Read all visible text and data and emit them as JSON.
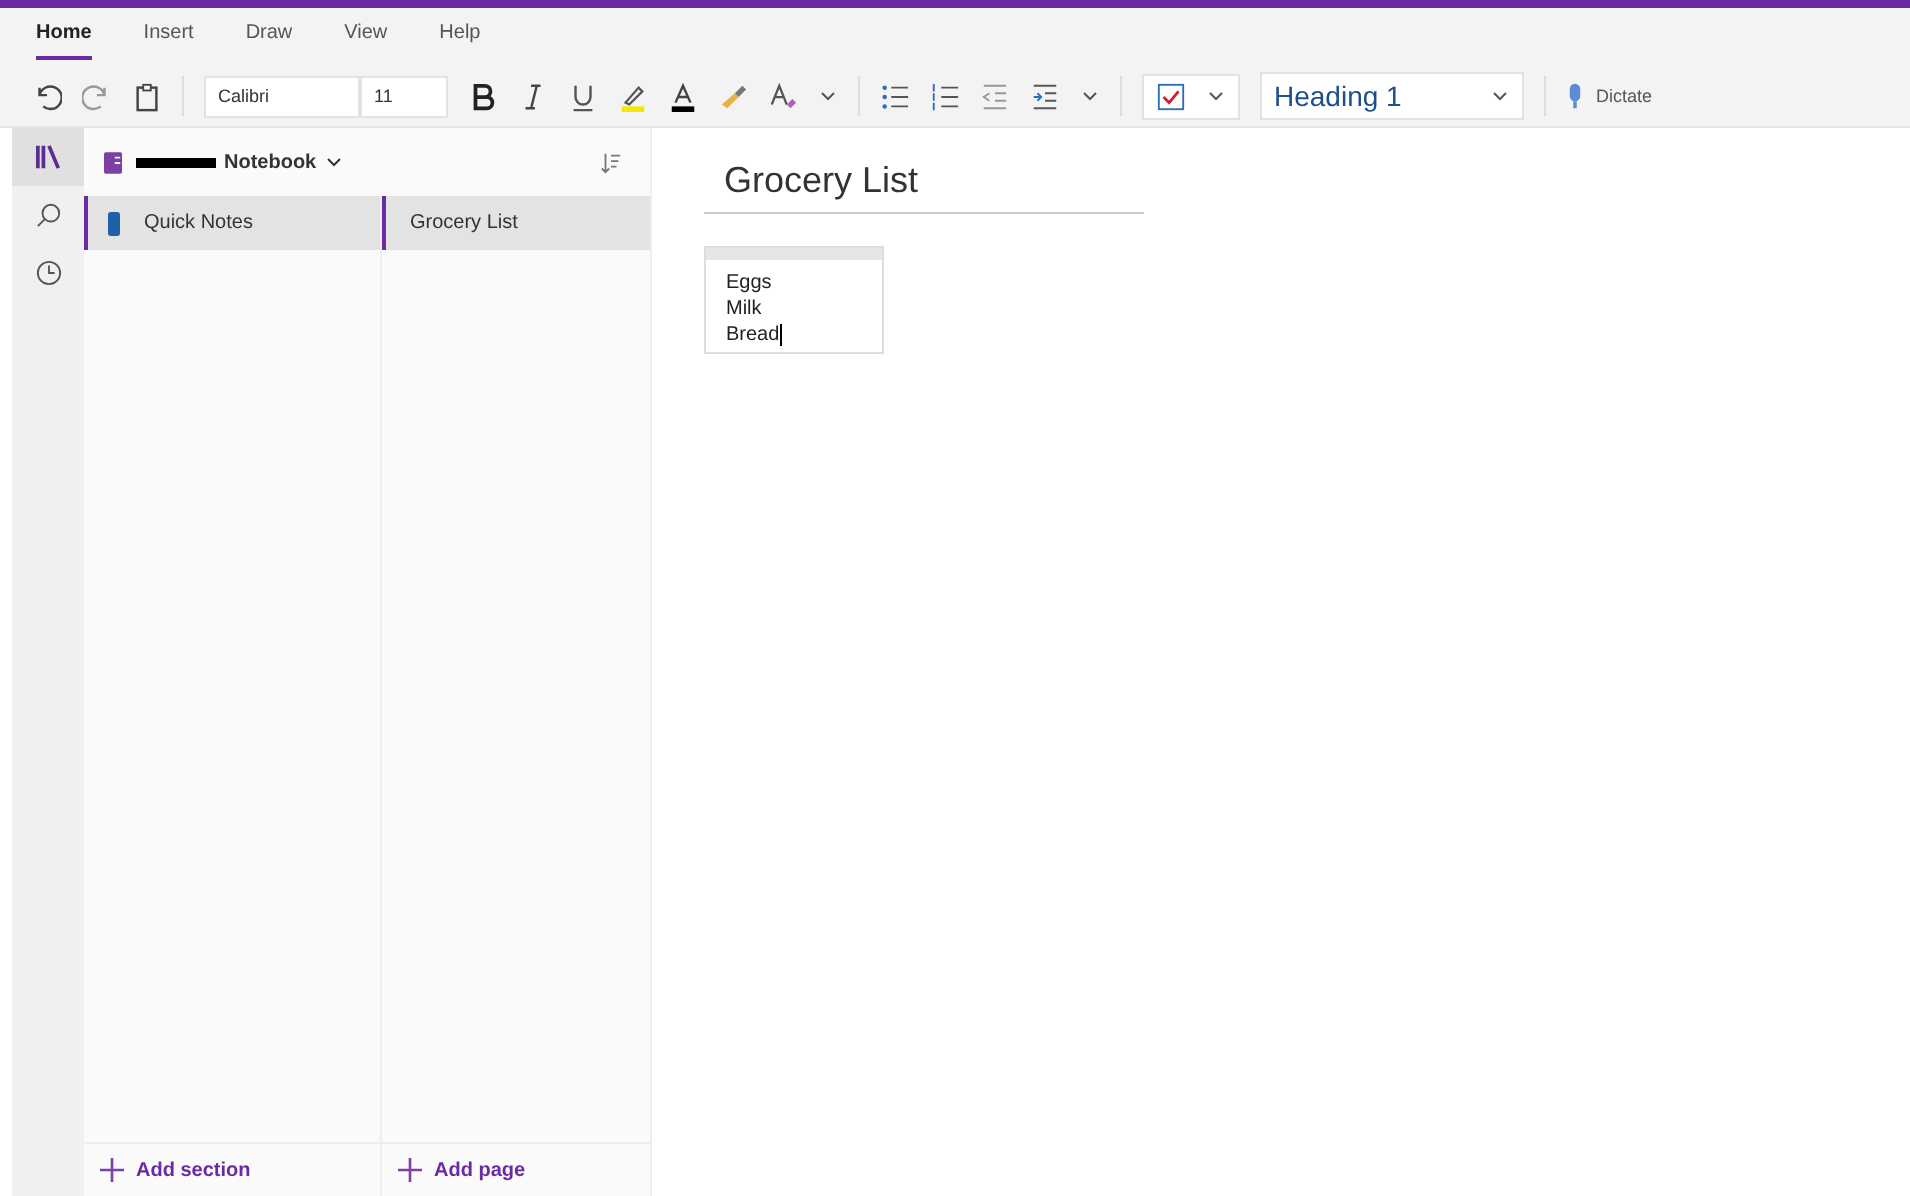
{
  "ribbon_tabs": [
    {
      "label": "Home",
      "selected": true
    },
    {
      "label": "Insert",
      "selected": false
    },
    {
      "label": "Draw",
      "selected": false
    },
    {
      "label": "View",
      "selected": false
    },
    {
      "label": "Help",
      "selected": false
    }
  ],
  "toolbar": {
    "font": "Calibri",
    "size": "11",
    "style": "Heading 1",
    "dictate": "Dictate"
  },
  "nav_rail": [
    {
      "kind": "notebooks",
      "selected": true
    },
    {
      "kind": "search",
      "selected": false
    },
    {
      "kind": "recent",
      "selected": false
    }
  ],
  "notebook": {
    "name": "Notebook"
  },
  "sections": [
    {
      "label": "Quick Notes",
      "selected": true
    }
  ],
  "pages": [
    {
      "label": "Grocery List",
      "selected": true
    }
  ],
  "add_section": "Add section",
  "add_page": "Add page",
  "page": {
    "title": "Grocery List",
    "lines": [
      "Eggs",
      "Milk",
      "Bread"
    ]
  }
}
